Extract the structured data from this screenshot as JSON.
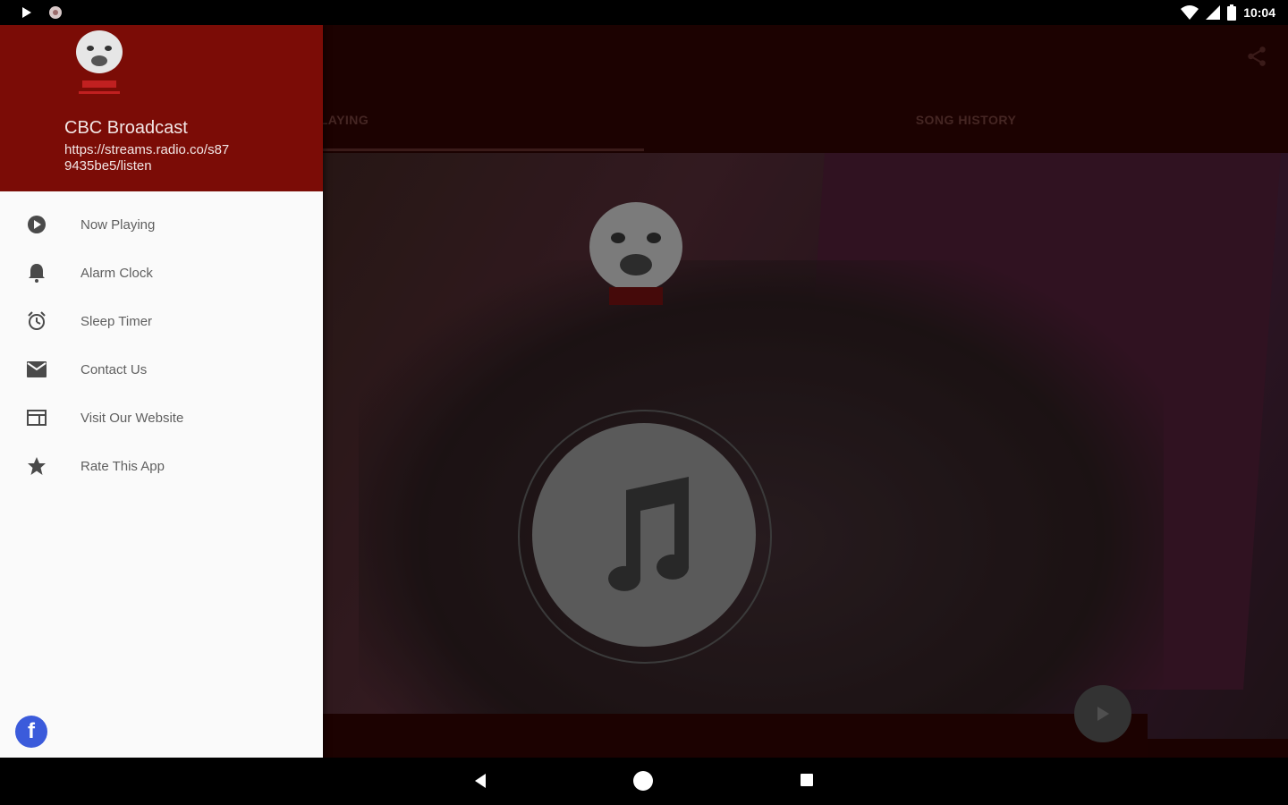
{
  "status_bar": {
    "time": "10:04"
  },
  "drawer": {
    "station_name": "CBC Broadcast",
    "station_url": "https://streams.radio.co/s879435be5/listen",
    "menu": [
      {
        "label": "Now Playing",
        "icon": "play-circle-icon"
      },
      {
        "label": "Alarm Clock",
        "icon": "bell-icon"
      },
      {
        "label": "Sleep Timer",
        "icon": "alarm-clock-icon"
      },
      {
        "label": "Contact Us",
        "icon": "mail-icon"
      },
      {
        "label": "Visit Our Website",
        "icon": "web-icon"
      },
      {
        "label": "Rate This App",
        "icon": "star-icon"
      }
    ],
    "facebook_label": "f"
  },
  "tabs": [
    {
      "label": "LAYING"
    },
    {
      "label": "SONG HISTORY"
    }
  ],
  "colors": {
    "drawer_header": "#7b0c06",
    "appbar": "#2c0403",
    "facebook": "#3b5bdb"
  }
}
